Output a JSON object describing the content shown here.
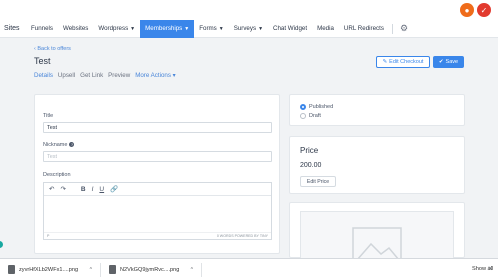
{
  "topbar": {
    "badge1": "●",
    "badge2": "✓"
  },
  "nav": {
    "brand": "Sites",
    "items": [
      {
        "label": "Funnels"
      },
      {
        "label": "Websites"
      },
      {
        "label": "Wordpress"
      },
      {
        "label": "Memberships"
      },
      {
        "label": "Forms"
      },
      {
        "label": "Surveys"
      },
      {
        "label": "Chat Widget"
      },
      {
        "label": "Media"
      },
      {
        "label": "URL Redirects"
      }
    ]
  },
  "header": {
    "back_link": "Back to offers",
    "title": "Test",
    "edit_checkout": "Edit Checkout",
    "save": "Save",
    "tabs": [
      "Details",
      "Upsell",
      "Get Link",
      "Preview",
      "More Actions"
    ]
  },
  "form": {
    "title_label": "Title",
    "title_value": "Test",
    "nickname_label": "Nickname",
    "nickname_placeholder": "Test",
    "description_label": "Description",
    "editor_path": "P",
    "editor_words": "0 WORDS  POWERED BY TINY"
  },
  "status": {
    "published": "Published",
    "draft": "Draft"
  },
  "price": {
    "heading": "Price",
    "value": "200.00",
    "edit_button": "Edit Price"
  },
  "downloads": {
    "files": [
      {
        "name": "zyvrHfXLb2WFx1....png"
      },
      {
        "name": "N2VkGQ9jymRvc....png"
      }
    ],
    "show_all": "Show all",
    "close": "×"
  },
  "colors": {
    "accent": "#3a86ea",
    "link": "#4a86d9"
  }
}
